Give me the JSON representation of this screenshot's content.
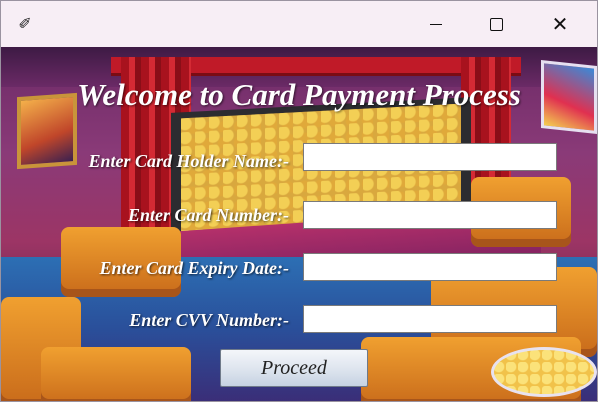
{
  "window": {
    "app_icon": "app-feather-icon",
    "minimize_icon": "minimize-icon",
    "maximize_icon": "maximize-icon",
    "close_icon": "close-icon",
    "close_glyph": "✕"
  },
  "form": {
    "heading": "Welcome to Card Payment Process",
    "card_holder_label": "Enter Card Holder Name:-",
    "card_holder_value": "",
    "card_number_label": "Enter Card Number:-",
    "card_number_value": "",
    "expiry_label": "Enter Card Expiry Date:-",
    "expiry_value": "",
    "cvv_label": "Enter CVV Number:-",
    "cvv_value": "",
    "proceed_label": "Proceed"
  },
  "colors": {
    "titlebar": "#f7eef5",
    "label_text": "#ffffff",
    "button_gradient_top": "#f4f6fa",
    "button_gradient_bottom": "#c6d2e2"
  }
}
